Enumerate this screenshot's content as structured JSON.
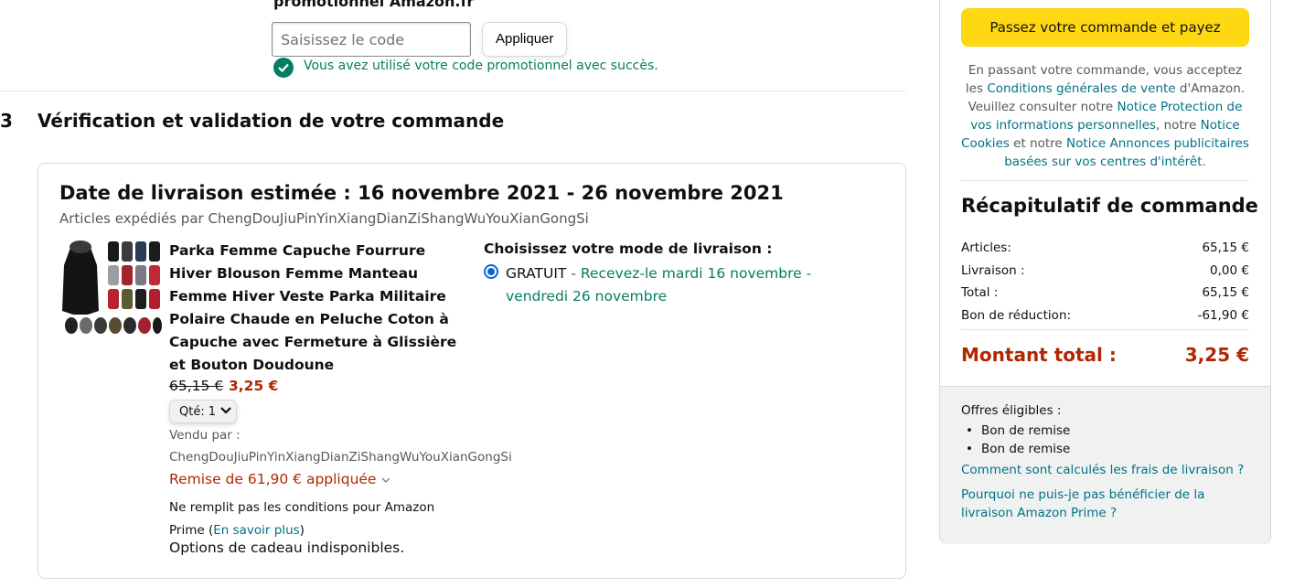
{
  "promo": {
    "heading": "promotionnel Amazon.fr",
    "placeholder": "Saisissez le code",
    "apply_label": "Appliquer",
    "success_text": "Vous avez utilisé votre code promotionnel avec succès."
  },
  "step": {
    "number": "3",
    "title": "Vérification et validation de votre commande"
  },
  "order": {
    "delivery_title": "Date de livraison estimée : 16 novembre 2021 - 26 novembre 2021",
    "shipped_by": "Articles expédiés par ChengDouJiuPinYinXiangDianZiShangWuYouXianGongSi",
    "product_title": "Parka Femme Capuche Fourrure Hiver Blouson Femme Manteau Femme Hiver Veste Parka Militaire Polaire Chaude en Peluche Coton à Capuche avec Fermeture à Glissière et Bouton Doudoune",
    "price_old": "65,15 €",
    "price_new": "3,25 €",
    "qty_label": "Qté:",
    "qty_value": "1",
    "sold_by_label": "Vendu par :",
    "sold_by_name": "ChengDouJiuPinYinXiangDianZiShangWuYouXianGongSi",
    "discount": "Remise de 61,90 € appliquée",
    "prime_note": "Ne remplit pas les conditions pour Amazon Prime (",
    "prime_link": "En savoir plus",
    "prime_close": ")",
    "gift": "Options de cadeau indisponibles.",
    "shipping_title": "Choisissez votre mode de livraison :",
    "shipping_free": "GRATUIT",
    "shipping_date": " - Recevez-le mardi 16 novembre - vendredi 26 novembre"
  },
  "sidebar": {
    "pay_label": "Passez votre commande et payez",
    "terms": {
      "t1": "En passant votre commande, vous acceptez les ",
      "l1": "Conditions générales de vente",
      "t2": " d'Amazon. Veuillez consulter notre ",
      "l2": "Notice Protection de vos informations personnelles",
      "t3": ", notre ",
      "l3": "Notice Cookies",
      "t4": " et notre ",
      "l4": "Notice Annonces publicitaires basées sur vos centres d'intérêt",
      "t5": "."
    },
    "summary_title": "Récapitulatif de commande",
    "rows": [
      {
        "label": "Articles:",
        "value": "65,15 €"
      },
      {
        "label": "Livraison :",
        "value": "0,00 €"
      },
      {
        "label": "Total :",
        "value": "65,15 €"
      },
      {
        "label": "Bon de réduction:",
        "value": "-61,90 €"
      }
    ],
    "total_label": "Montant total :",
    "total_value": "3,25 €",
    "offers_label": "Offres éligibles :",
    "offers": [
      "Bon de remise",
      "Bon de remise"
    ],
    "faq1": "Comment sont calculés les frais de livraison ?",
    "faq2": "Pourquoi ne puis-je pas bénéficier de la livraison Amazon Prime ?"
  },
  "colors": {
    "accent_yellow": "#ffd814",
    "link": "#007185",
    "success": "#067d62",
    "price_red": "#b12704"
  }
}
